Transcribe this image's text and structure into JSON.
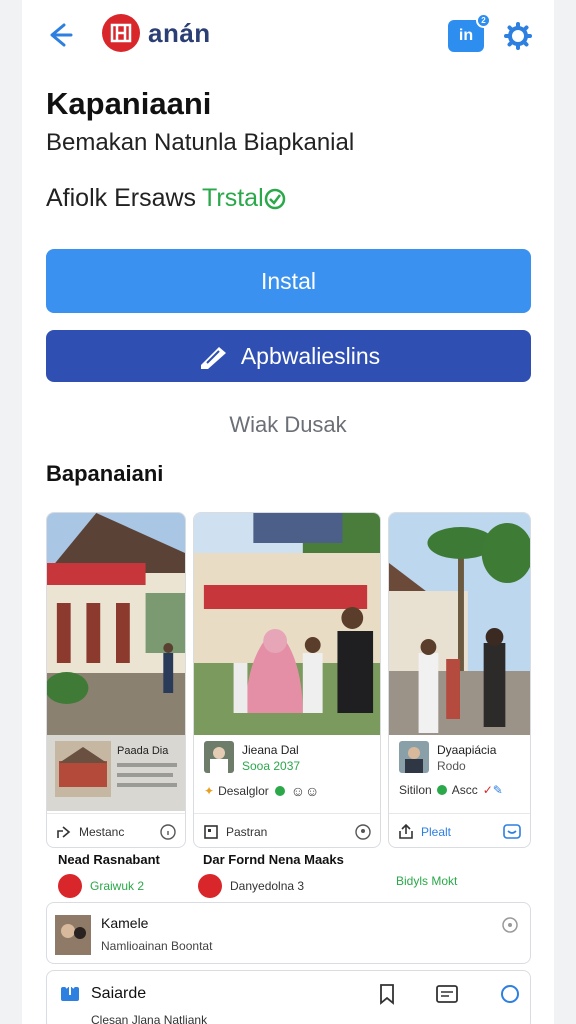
{
  "app": {
    "brand_name": "anán",
    "notification_count": "2",
    "badge_label": "in"
  },
  "header": {
    "title": "Kapaniaani",
    "subtitle": "Bemakan Natunla Biapkanial",
    "meta_text": "Afiolk Ersaws",
    "meta_status": "Trstal"
  },
  "actions": {
    "install_label": "Instal",
    "secondary_label": "Apbwalieslins",
    "link_label": "Wiak Dusak"
  },
  "section": {
    "title": "Bapanaiani"
  },
  "cards": [
    {
      "name": "Paada Dia",
      "sub": "",
      "stats": "",
      "footer_label": "Mestanc",
      "footer_icon": "share-icon"
    },
    {
      "name": "Jieana Dal",
      "sub": "Sooa 2037",
      "stats": "Desalglor",
      "footer_label": "Pastran",
      "footer_icon": "bookmark-icon"
    },
    {
      "name": "Dyaapiácia",
      "sub": "Rodo",
      "stats": "Sitilon",
      "stats2": "Ascc",
      "footer_label": "Plealt",
      "footer_icon": "share-icon"
    }
  ],
  "users": [
    {
      "name": "Nead Rasnabant",
      "status": "Graiwuk 2"
    },
    {
      "name": "Dar Fornd Nena Maaks",
      "status": "Danyedolna 3"
    },
    {
      "name": "",
      "status": "Bidyls Mokt"
    }
  ],
  "comment": {
    "author": "Kamele",
    "text": "Namlioainan Boontat"
  },
  "bottom_nav": {
    "label": "Saiarde",
    "sub": "Clesan Jlana Natliank"
  },
  "colors": {
    "accent": "#3b91ef",
    "secondary": "#2f4fb3",
    "brand_red": "#d8262b",
    "green": "#2aa84a"
  }
}
